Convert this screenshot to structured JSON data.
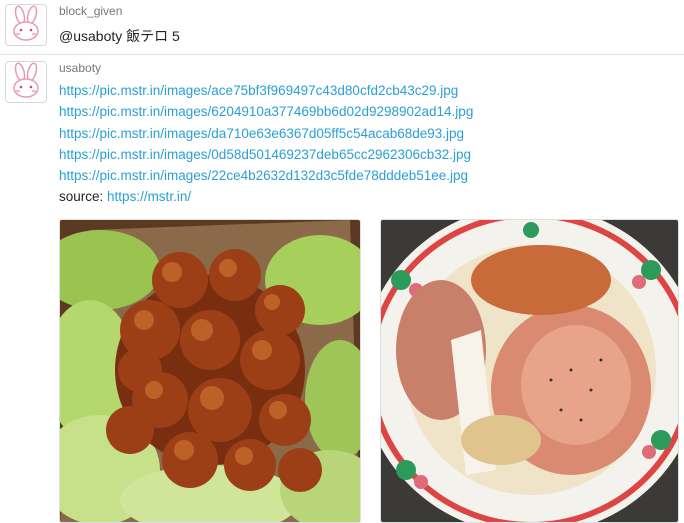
{
  "posts": [
    {
      "username": "block_given",
      "message": "@usaboty 飯テロ 5"
    },
    {
      "username": "usaboty",
      "links": [
        "https://pic.mstr.in/images/ace75bf3f969497c43d80cfd2cb43c29.jpg",
        "https://pic.mstr.in/images/6204910a377469bb6d02d9298902ad14.jpg",
        "https://pic.mstr.in/images/da710e63e6367d05ff5c54acab68de93.jpg",
        "https://pic.mstr.in/images/0d58d501469237deb65cc2962306cb32.jpg",
        "https://pic.mstr.in/images/22ce4b2632d132d3c5fde78dddeb51ee.jpg"
      ],
      "source_label": "source:",
      "source_url": "https://mstr.in/"
    }
  ],
  "colors": {
    "link": "#2a9fd6",
    "username": "#777777",
    "divider": "#e3e3e3"
  },
  "icons": {
    "avatar": "rabbit-avatar-icon"
  }
}
